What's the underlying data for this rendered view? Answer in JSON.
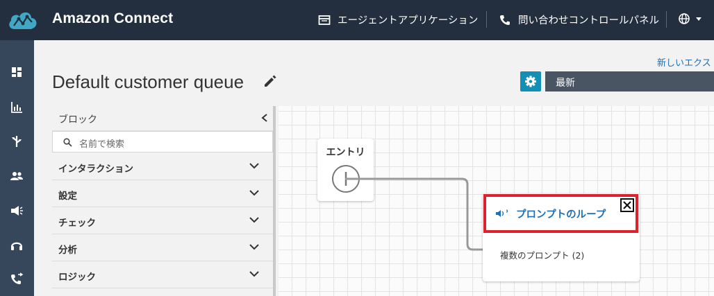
{
  "header": {
    "brand": "Amazon Connect",
    "agent_app": "エージェントアプリケーション",
    "contact_panel": "問い合わせコントロールパネル"
  },
  "page": {
    "title": "Default customer queue",
    "new_link": "新しいエクス",
    "version_select": "最新"
  },
  "blocks": {
    "heading": "ブロック",
    "search_placeholder": "名前で検索",
    "categories": [
      "インタラクション",
      "設定",
      "チェック",
      "分析",
      "ロジック"
    ]
  },
  "canvas": {
    "entry_label": "エントリ",
    "loop_node": {
      "title": "プロンプトのループ",
      "branch": "複数のプロンプト (2)"
    }
  },
  "colors": {
    "topbar": "#232f3e",
    "rail": "#36475c",
    "accent": "#138fb5",
    "highlight": "#e0202b",
    "link": "#1f6fb5"
  }
}
